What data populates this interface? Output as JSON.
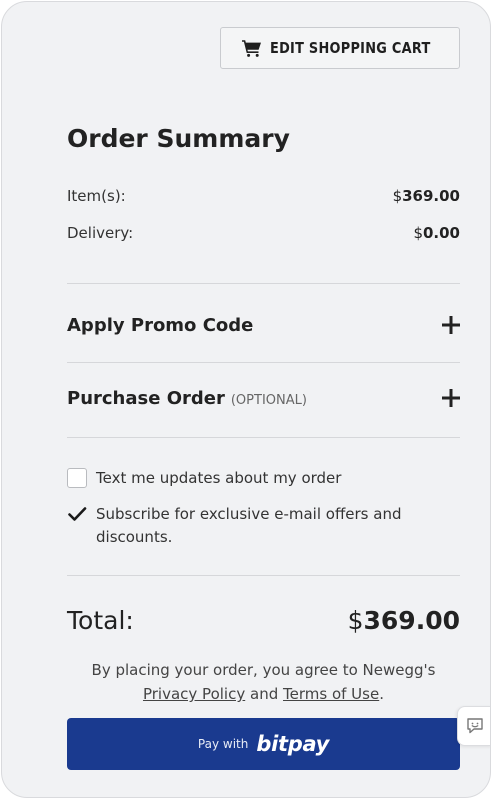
{
  "header": {
    "edit_cart_label": "EDIT SHOPPING CART",
    "edit_cart_icon": "cart-icon"
  },
  "summary": {
    "title": "Order Summary",
    "items_label": "Item(s):",
    "items_currency": "$",
    "items_amount": "369.00",
    "delivery_label": "Delivery:",
    "delivery_currency": "$",
    "delivery_amount": "0.00"
  },
  "sections": {
    "promo_label": "Apply Promo Code",
    "purchase_order_label": "Purchase Order",
    "purchase_order_optional": "(OPTIONAL)",
    "expand_icon": "plus-icon"
  },
  "options": {
    "text_updates_label": "Text me updates about my order",
    "text_updates_checked": false,
    "subscribe_label": "Subscribe for exclusive e-mail offers and discounts.",
    "subscribe_checked": true
  },
  "total": {
    "label": "Total:",
    "currency": "$",
    "amount": "369.00"
  },
  "legal": {
    "prefix": "By placing your order, you agree to Newegg's",
    "privacy_link": "Privacy Policy",
    "and": "and",
    "terms_link": "Terms of Use",
    "suffix": "."
  },
  "pay": {
    "prefix": "Pay with",
    "brand": "bitpay",
    "color": "#1a3a8f"
  },
  "feedback": {
    "icon": "feedback-chat-icon"
  }
}
